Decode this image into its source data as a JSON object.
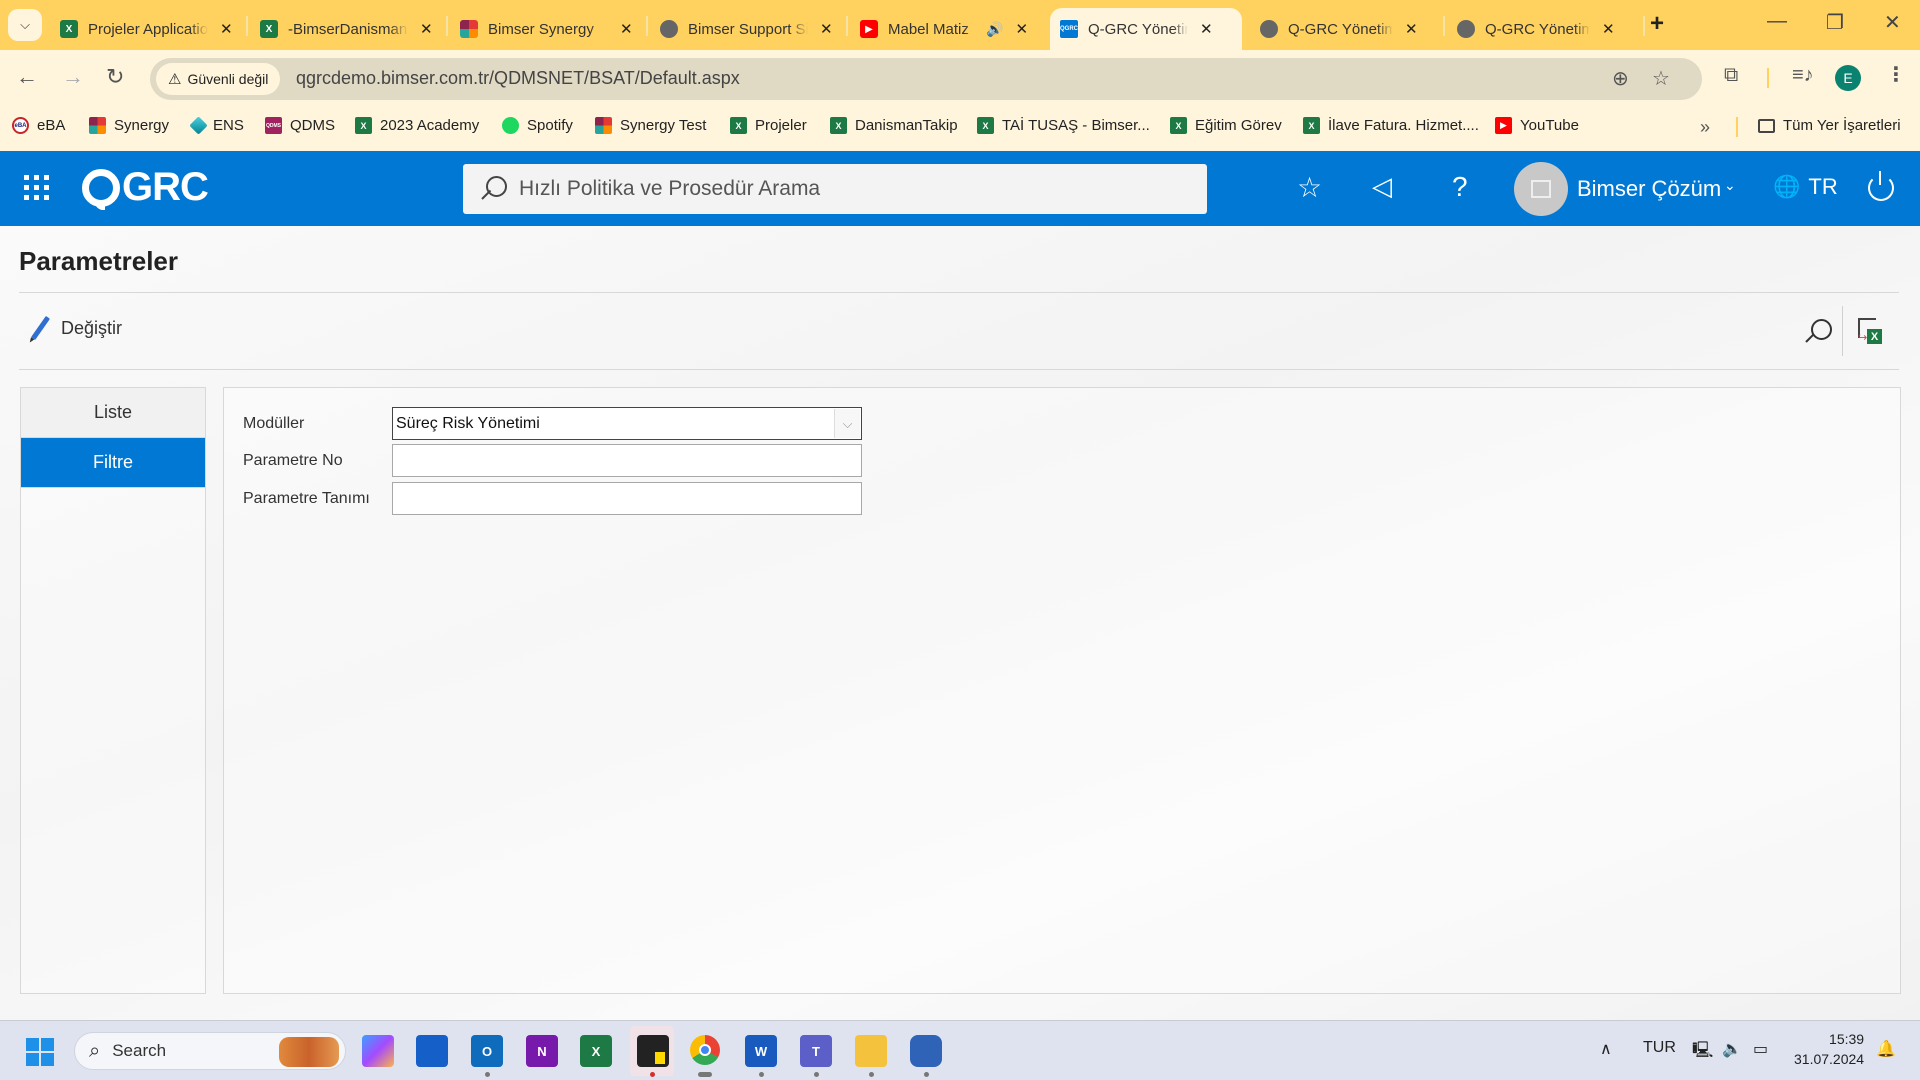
{
  "browser": {
    "tabs": [
      {
        "title": "Projeler Application",
        "icon": "excel-icon",
        "active": false
      },
      {
        "title": "-BimserDanismanlik",
        "icon": "excel-icon",
        "active": false
      },
      {
        "title": "Bimser Synergy",
        "icon": "synergy-icon",
        "active": false
      },
      {
        "title": "Bimser Support Sistemi",
        "icon": "globe-icon",
        "active": false
      },
      {
        "title": "Mabel Matiz",
        "icon": "youtube-icon",
        "active": false,
        "audio": true
      },
      {
        "title": "Q-GRC Yönetim Sistemi",
        "icon": "qgrc-icon",
        "active": true
      },
      {
        "title": "Q-GRC Yönetim Sistemi",
        "icon": "globe-icon",
        "active": false
      },
      {
        "title": "Q-GRC Yönetim Sistemi",
        "icon": "globe-icon",
        "active": false
      }
    ],
    "new_tab": "+",
    "security_label": "Güvenli değil",
    "url": "qgrcdemo.bimser.com.tr/QDMSNET/BSAT/Default.aspx",
    "profile_initial": "E",
    "bookmarks": [
      {
        "label": "eBA",
        "icon": "eba-icon"
      },
      {
        "label": "Synergy",
        "icon": "synergy-icon"
      },
      {
        "label": "ENS",
        "icon": "ens-icon"
      },
      {
        "label": "QDMS",
        "icon": "qdms-icon"
      },
      {
        "label": "2023 Academy",
        "icon": "excel-icon"
      },
      {
        "label": "Spotify",
        "icon": "spotify-icon"
      },
      {
        "label": "Synergy Test",
        "icon": "synergy-icon"
      },
      {
        "label": "Projeler",
        "icon": "excel-icon"
      },
      {
        "label": "DanismanTakip",
        "icon": "excel-icon"
      },
      {
        "label": "TAİ TUSAŞ - Bimser...",
        "icon": "excel-icon"
      },
      {
        "label": "Eğitim Görev",
        "icon": "excel-icon"
      },
      {
        "label": "İlave Fatura. Hizmet....",
        "icon": "excel-icon"
      },
      {
        "label": "YouTube",
        "icon": "youtube-icon"
      }
    ],
    "bookmarks_overflow": "»",
    "all_bookmarks": "Tüm Yer İşaretleri"
  },
  "app": {
    "logo_text": "GRC",
    "search_placeholder": "Hızlı Politika ve Prosedür Arama",
    "user_name": "Bimser Çözüm",
    "language": "TR",
    "brand_color": "#0078D4"
  },
  "page": {
    "title": "Parametreler",
    "toolbar": {
      "edit_label": "Değiştir"
    },
    "side_tabs": [
      {
        "label": "Liste",
        "active": false
      },
      {
        "label": "Filtre",
        "active": true
      }
    ],
    "filter_form": {
      "modules_label": "Modüller",
      "modules_value": "Süreç Risk Yönetimi",
      "param_no_label": "Parametre No",
      "param_no_value": "",
      "param_def_label": "Parametre Tanımı",
      "param_def_value": ""
    }
  },
  "taskbar": {
    "search_label": "Search",
    "language": "TUR",
    "time": "15:39",
    "date": "31.07.2024"
  }
}
